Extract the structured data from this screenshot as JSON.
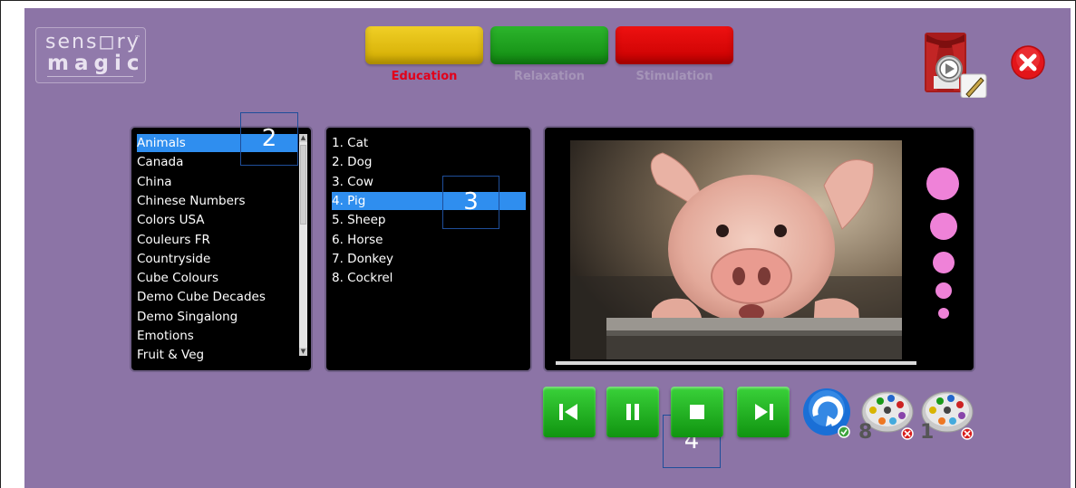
{
  "logo": {
    "line1": "sens◻ry",
    "line2": "magic",
    "tm": "™"
  },
  "categories": [
    {
      "label": "Education",
      "color": "#e1bb00",
      "label_color": "#e2001a",
      "active": true
    },
    {
      "label": "Relaxation",
      "color": "#1ea11e",
      "label_color": "#a594b8",
      "active": false
    },
    {
      "label": "Stimulation",
      "color": "#dc0000",
      "label_color": "#a594b8",
      "active": false
    }
  ],
  "topics": {
    "items": [
      "Animals",
      "Canada",
      "China",
      "Chinese Numbers",
      "Colors USA",
      "Couleurs FR",
      "Countryside",
      "Cube Colours",
      "Demo Cube Decades",
      "Demo Singalong",
      "Emotions",
      "Fruit & Veg"
    ],
    "selected_index": 0
  },
  "tracks": {
    "items": [
      "1.  Cat",
      "2.  Dog",
      "3.  Cow",
      "4.  Pig",
      "5.  Sheep",
      "6.  Horse",
      "7.  Donkey",
      "8.  Cockrel"
    ],
    "selected_index": 3
  },
  "preview": {
    "subject": "pig-photo",
    "progress": 0.0
  },
  "annotations": {
    "a2": "2",
    "a3": "3",
    "a4": "4"
  },
  "controls": {
    "previous_icon": "skip-previous-icon",
    "pause_icon": "pause-icon",
    "stop_icon": "stop-icon",
    "next_icon": "skip-next-icon",
    "repeat_icon": "repeat-icon",
    "cube1_count": "8",
    "cube2_count": "1"
  },
  "colors": {
    "background": "#8c74a6",
    "selection": "#2f8eef",
    "dots": "#ef82d8",
    "control_green": "#1fb31f"
  },
  "icons": {
    "editor": "theatre-editor-icon",
    "close": "close-icon"
  }
}
